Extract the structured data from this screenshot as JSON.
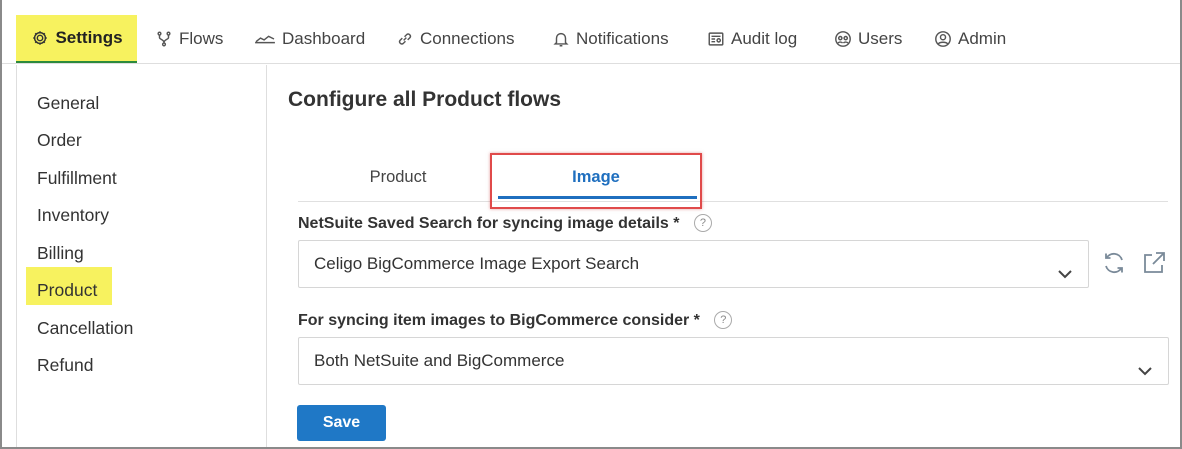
{
  "nav": {
    "items": [
      {
        "label": "Settings",
        "icon": "gear-icon"
      },
      {
        "label": "Flows",
        "icon": "flows-icon"
      },
      {
        "label": "Dashboard",
        "icon": "dashboard-icon"
      },
      {
        "label": "Connections",
        "icon": "link-icon"
      },
      {
        "label": "Notifications",
        "icon": "bell-icon"
      },
      {
        "label": "Audit log",
        "icon": "audit-icon"
      },
      {
        "label": "Users",
        "icon": "users-icon"
      },
      {
        "label": "Admin",
        "icon": "admin-icon"
      }
    ],
    "active": "Settings",
    "highlight_color": "#f7f25f"
  },
  "sidebar": {
    "items": [
      {
        "label": "General"
      },
      {
        "label": "Order"
      },
      {
        "label": "Fulfillment"
      },
      {
        "label": "Inventory"
      },
      {
        "label": "Billing"
      },
      {
        "label": "Product"
      },
      {
        "label": "Cancellation"
      },
      {
        "label": "Refund"
      }
    ],
    "active": "Product"
  },
  "main": {
    "title": "Configure all Product flows",
    "tabs": [
      {
        "label": "Product"
      },
      {
        "label": "Image"
      }
    ],
    "active_tab": "Image",
    "accent_color": "#1f6fbf",
    "fields": [
      {
        "label": "NetSuite Saved Search for syncing image details *",
        "help": "?",
        "value": "Celigo BigCommerce Image Export Search",
        "actions": [
          "refresh-icon",
          "open-external-icon"
        ]
      },
      {
        "label": "For syncing item images to BigCommerce consider *",
        "help": "?",
        "value": "Both NetSuite and BigCommerce"
      }
    ],
    "save_label": "Save"
  }
}
